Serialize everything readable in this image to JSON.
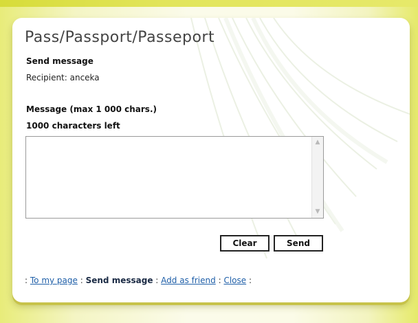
{
  "window": {
    "title": "Pass/Passport/Passeport",
    "subtitle": "Send message",
    "recipient": "Recipient: anceka"
  },
  "form": {
    "message_label": "Message (max 1 000 chars.)",
    "chars_left": "1000 characters left",
    "message_value": "",
    "clear_label": "Clear",
    "send_label": "Send"
  },
  "nav": {
    "separator": ":",
    "items": [
      {
        "label": "To my page",
        "link": true
      },
      {
        "label": "Send message",
        "link": false
      },
      {
        "label": "Add as friend",
        "link": true
      },
      {
        "label": "Close",
        "link": true
      }
    ]
  },
  "colors": {
    "link": "#1f5fa8",
    "accent_yellow": "#d7dc3a",
    "panel_bg": "#ffffff"
  },
  "icons": {
    "scroll_up": "scroll-up-arrow-icon",
    "scroll_down": "scroll-down-arrow-icon"
  }
}
